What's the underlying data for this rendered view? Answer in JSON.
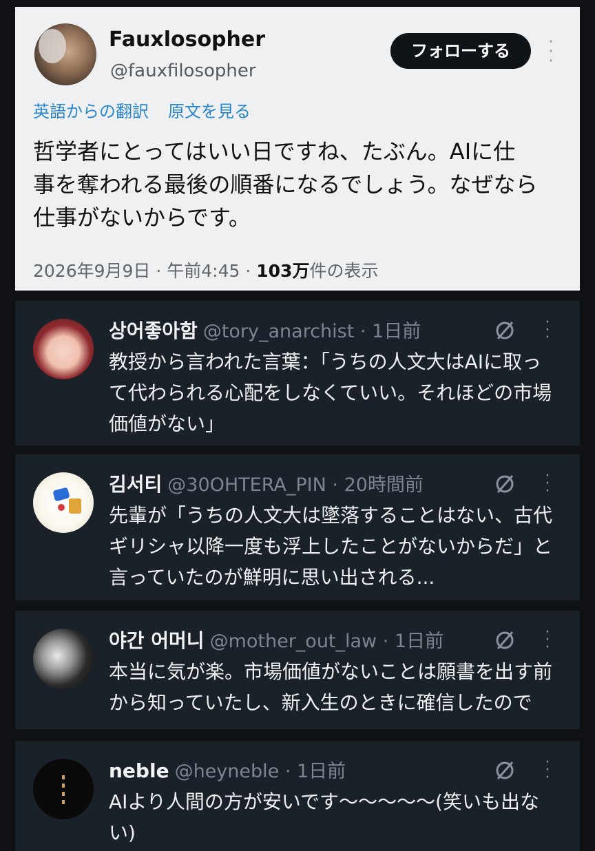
{
  "main_tweet": {
    "name": "Fauxlosopher",
    "handle": "@fauxfilosopher",
    "follow_label": "フォローする",
    "translation_note": "英語からの翻訳",
    "see_original": "原文を見る",
    "text_lines": [
      "哲学者にとってはいい日ですね、たぶん。AIに仕",
      "事を奪われる最後の順番になるでしょう。なぜなら",
      "仕事がないからです。"
    ],
    "meta_date": "2026年9月9日 · 午前4:45 · ",
    "meta_views_count": "103万",
    "meta_views_suffix": "件の表示"
  },
  "replies": [
    {
      "name": "상어좋아함",
      "handle": "@tory_anarchist · 1日前",
      "text_lines": [
        "教授から言われた言葉：「うちの人文大はAIに取っ",
        "て代わられる心配をしなくていい。それほどの市場",
        "価値がない」"
      ]
    },
    {
      "name": "김서티",
      "handle": "@30OHTERA_PIN · 20時間前",
      "text_lines": [
        "先輩が「うちの人文大は墜落することはない、古代",
        "ギリシャ以降一度も浮上したことがないからだ」と",
        "言っていたのが鮮明に思い出される..."
      ]
    },
    {
      "name": "야간 어머니",
      "handle": "@mother_out_law · 1日前",
      "text_lines": [
        "本当に気が楽。市場価値がないことは願書を出す前",
        "から知っていたし、新入生のときに確信したので"
      ]
    },
    {
      "name": "neble",
      "handle": "@heyneble · 1日前",
      "text_lines": [
        "AIより人間の方が安いです〜〜〜〜〜(笑いも出な",
        "い)"
      ]
    }
  ],
  "icons": {
    "more": "more-vertical-icon",
    "mute": "mute-icon"
  },
  "colors": {
    "background": "#101114",
    "main_card": "#eef0f2",
    "reply_card": "#1b2129",
    "link_blue": "#2a86cc",
    "follow_button": "#0f1419"
  }
}
